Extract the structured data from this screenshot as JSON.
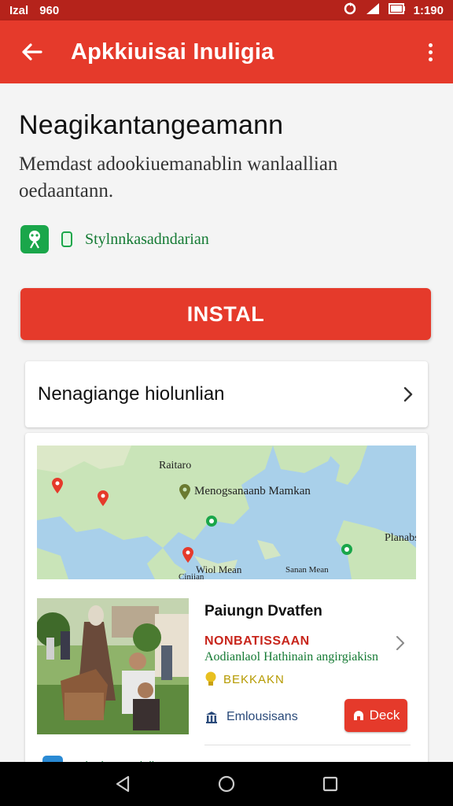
{
  "status_bar": {
    "left_label_1": "Izal",
    "left_label_2": "960",
    "time": "1:190"
  },
  "app_bar": {
    "title": "Apkkiuisai Inuligia"
  },
  "app": {
    "name": "Neagikantangeamann",
    "description": "Memdast adookiuemanablin wanlaallian oedaantann.",
    "developer": "Stylnnkasadndarian"
  },
  "install_button": "INSTAL",
  "expand_row": {
    "label": "Nenagiange hiolunlian"
  },
  "map": {
    "label_top": "Raitaro",
    "label_center": "Menogsanaanb Mamkan",
    "label_right": "Planabs",
    "label_bottom_left": "Wiol Mean",
    "label_bottom_scale": "Sanan Mean",
    "label_corner": "Ciniian"
  },
  "place": {
    "title": "Paiungn Dvatfen",
    "subtitle": "NONBATISSAAN",
    "description": "Aodianlaol Hathinain angirgiakisn",
    "rating": "BEKKAKN",
    "info": "Emlousisans",
    "action_button": "Deck"
  },
  "peek": {
    "text": "Iulaalaun aulali"
  },
  "colors": {
    "primary": "#e53a2b",
    "status_bar": "#b5231b",
    "developer_green": "#1aa64a"
  }
}
